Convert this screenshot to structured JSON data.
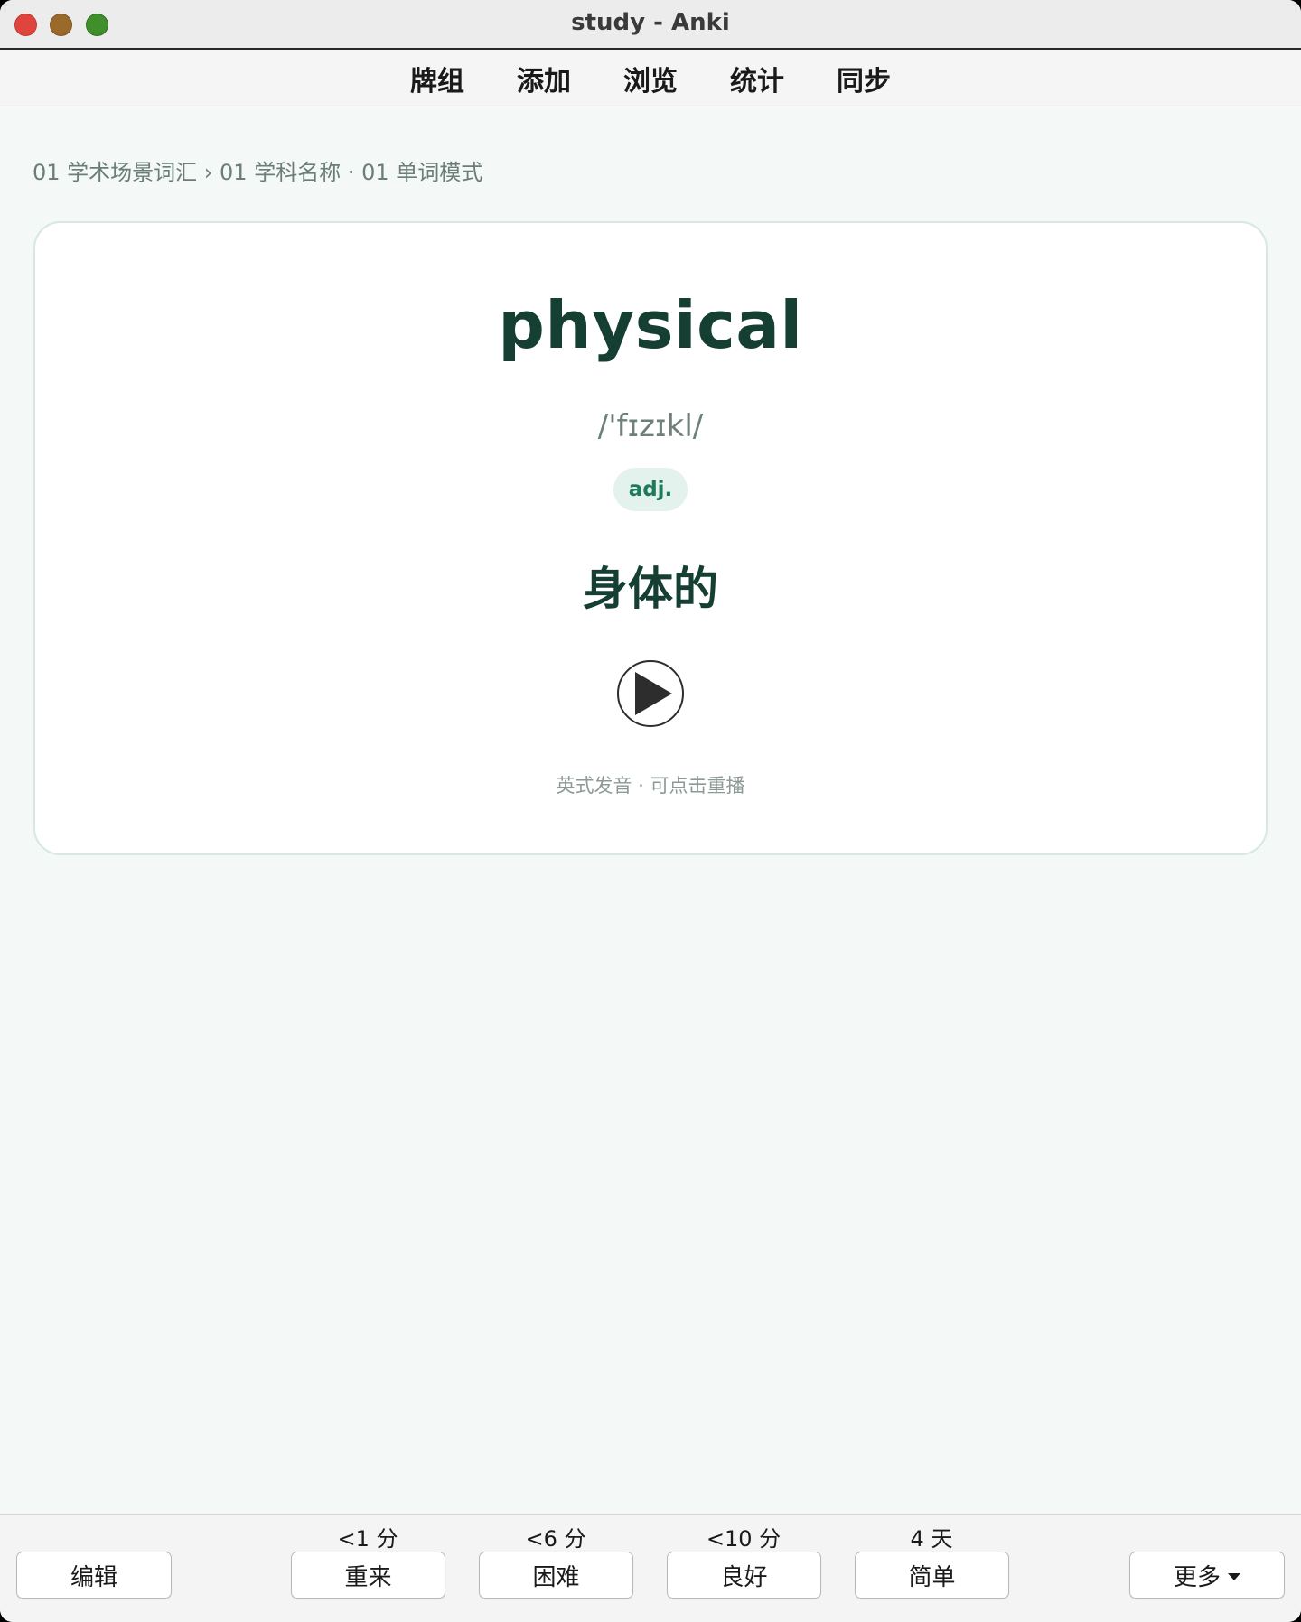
{
  "window": {
    "title": "study - Anki"
  },
  "toolbar": {
    "items": [
      "牌组",
      "添加",
      "浏览",
      "统计",
      "同步"
    ]
  },
  "breadcrumb": "01 学术场景词汇 › 01 学科名称 · 01 单词模式",
  "card": {
    "word": "physical",
    "phonetic": "/'fɪzɪkl/",
    "part_of_speech": "adj.",
    "meaning": "身体的",
    "play_icon": "play-icon",
    "hint": "英式发音 · 可点击重播"
  },
  "bottom": {
    "edit_label": "编辑",
    "answers": [
      {
        "interval": "<1 分",
        "label": "重来"
      },
      {
        "interval": "<6 分",
        "label": "困难"
      },
      {
        "interval": "<10 分",
        "label": "良好"
      },
      {
        "interval": "4 天",
        "label": "简单"
      }
    ],
    "more_label": "更多"
  },
  "colors": {
    "accent": "#1d7a5c",
    "word": "#153f32",
    "card_border": "#d7e8e3",
    "background": "#f4f8f7"
  }
}
